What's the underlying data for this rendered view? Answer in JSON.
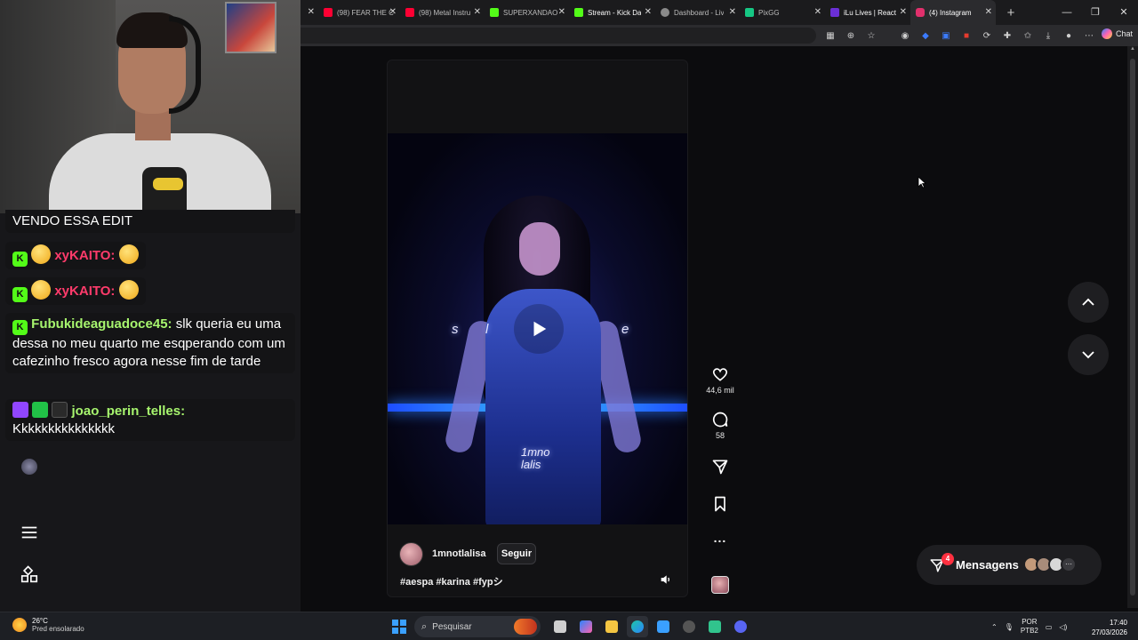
{
  "browser": {
    "tabs": [
      {
        "title": "",
        "active": false,
        "color": "#2b84ff"
      },
      {
        "title": "(98) FEAR THE C",
        "active": false,
        "color": "#ff0033"
      },
      {
        "title": "(98) Metal Instru",
        "active": false,
        "color": "#ff0033"
      },
      {
        "title": "SUPERXANDAO",
        "active": false,
        "color": "#53fc18"
      },
      {
        "title": "Stream - Kick Da",
        "active": false,
        "color": "#53fc18"
      },
      {
        "title": "Dashboard - Liv",
        "active": false,
        "color": "#8a8a8a"
      },
      {
        "title": "PixGG",
        "active": false,
        "color": "#16c784"
      },
      {
        "title": "iLu Lives | React",
        "active": false,
        "color": "#6b2fd6"
      },
      {
        "title": "(4) Instagram",
        "active": true,
        "color": "#e1306c"
      }
    ],
    "new_tab": "+",
    "window_controls": {
      "minimize": "—",
      "maximize": "❐",
      "close": "✕"
    },
    "toolbar_icons": [
      "grid-icon",
      "zoom-icon",
      "star-icon",
      "extension-icon",
      "shield-icon",
      "translate-icon",
      "pdf-icon",
      "refresh-icon",
      "puzzle-icon",
      "favorites-icon",
      "download-icon",
      "profile-icon",
      "more-icon"
    ],
    "chat_label": "Chat"
  },
  "reel": {
    "lyric_left": "s",
    "lyric_mid": "l",
    "lyric_right": "e",
    "overlay_line1": "1mno",
    "overlay_line2": "lalis",
    "username": "1mnotlalisa",
    "follow_label": "Seguir",
    "caption": "#aespa #karina #fypシ"
  },
  "actions": {
    "likes": "44,6 mil",
    "comments": "58",
    "more": "..."
  },
  "messages": {
    "badge": "4",
    "label": "Mensagens",
    "more": "···"
  },
  "chat": {
    "line0": "VENDO ESSA EDIT",
    "line1_user": "xyKAITO:",
    "line2_user": "xyKAITO:",
    "line3_user": "Fubukideaguadoce45:",
    "line3_msg": " slk queria eu uma dessa no meu quarto me esqperando com um cafezinho fresco agora nesse fim de tarde",
    "line4_user": "joao_perin_telles:",
    "line4_msg": "Kkkkkkkkkkkkkkk",
    "kick_letter": "K"
  },
  "taskbar": {
    "temp": "26°C",
    "weather_desc": "Pred ensolarado",
    "search_placeholder": "Pesquisar",
    "lang_line1": "POR",
    "lang_line2": "PTB2",
    "time": "17:40",
    "date": "27/03/2026"
  }
}
